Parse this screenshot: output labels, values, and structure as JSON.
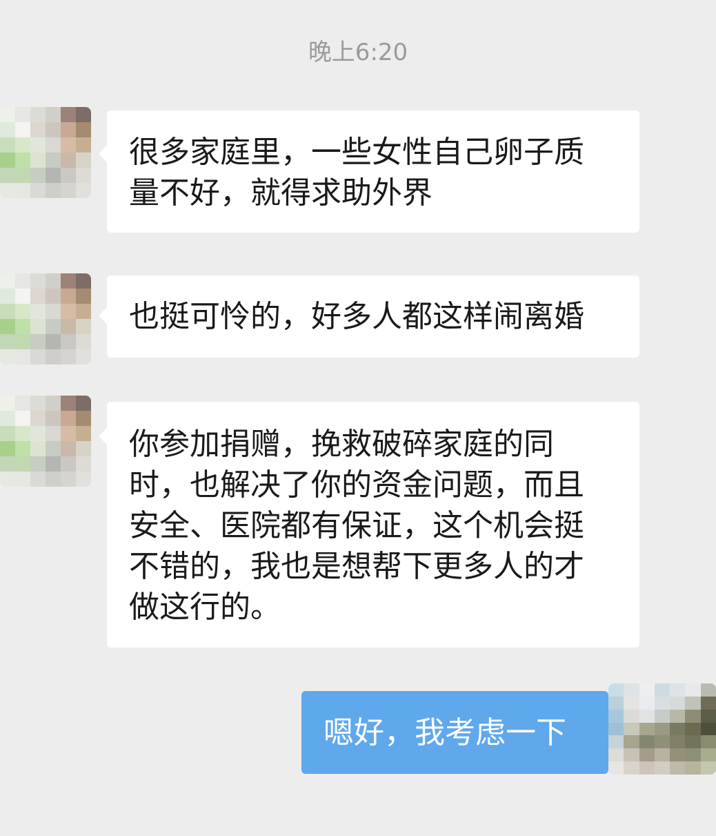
{
  "chat": {
    "timestamp": "晚上6:20",
    "messages": [
      {
        "sender": "other",
        "lines": [
          "很多家庭里，一些女性自己卵子质",
          "量不好，就得求助外界"
        ]
      },
      {
        "sender": "other",
        "lines": [
          "也挺可怜的，好多人都这样闹离婚"
        ]
      },
      {
        "sender": "other",
        "lines": [
          "你参加捐赠，挽救破碎家庭的同",
          "时，也解决了你的资金问题，而且",
          "安全、医院都有保证，这个机会挺",
          "不错的，我也是想帮下更多人的才",
          "做这行的。"
        ]
      },
      {
        "sender": "self",
        "lines": [
          "嗯好，我考虑一下"
        ]
      }
    ]
  },
  "colors": {
    "background": "#ededed",
    "incoming_bubble": "#ffffff",
    "outgoing_bubble": "#5fa8ec",
    "timestamp_text": "#9a9a9a"
  }
}
